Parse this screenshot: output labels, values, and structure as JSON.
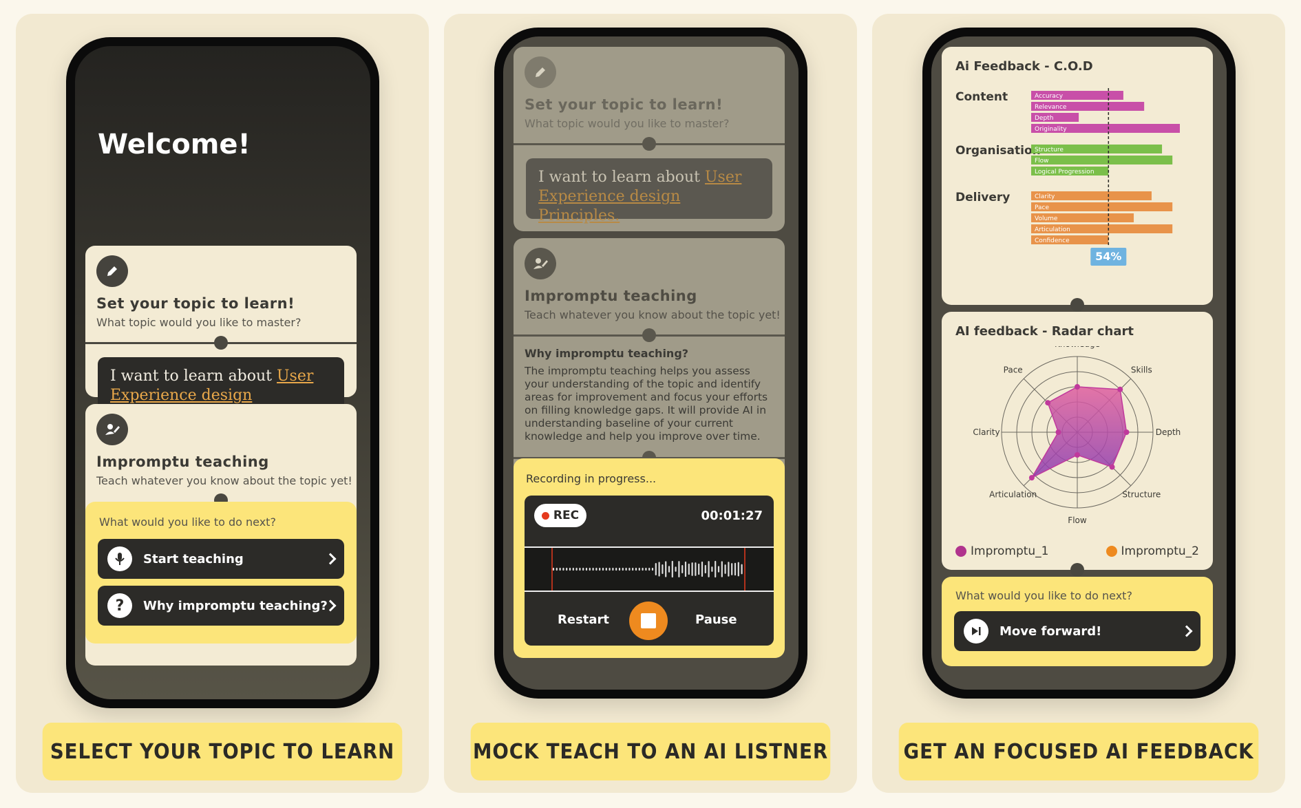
{
  "captions": [
    "SELECT YOUR TOPIC TO LEARN",
    "MOCK TEACH TO AN AI LISTNER",
    "GET AN FOCUSED AI FEEDBACK"
  ],
  "screen1": {
    "welcome": "Welcome!",
    "topic_card": {
      "title": "Set your topic to learn!",
      "subtitle": "What topic would you like to master?"
    },
    "topic_text_prefix": "I want to learn about ",
    "topic_text_highlight": "User Experience design Principles.",
    "impromptu_card": {
      "title": "Impromptu teaching",
      "subtitle": "Teach whatever you know about the topic yet!"
    },
    "next_prompt": "What would you like to do next?",
    "start_button": "Start teaching",
    "why_button": "Why impromptu teaching?"
  },
  "screen2": {
    "topic_card": {
      "title": "Set your topic to learn!",
      "subtitle": "What topic would you like to master?"
    },
    "topic_text_prefix": "I want to learn about ",
    "topic_text_highlight": "User Experience design Principles.",
    "impromptu_card": {
      "title": "Impromptu teaching",
      "subtitle": "Teach whatever you know about the topic yet!"
    },
    "why_title": "Why impromptu teaching?",
    "why_body": "The impromptu teaching helps you assess your understanding of the topic and identify areas for improvement and focus your efforts on filling knowledge gaps. It will provide AI in understanding baseline of your current knowledge and help you improve over time.",
    "recording_status": "Recording in progress...",
    "rec_label": "REC",
    "timer": "00:01:27",
    "restart_label": "Restart",
    "pause_label": "Pause"
  },
  "screen3": {
    "bar_title": "Ai Feedback - C.O.D",
    "radar_title": "AI feedback - Radar chart",
    "next_prompt": "What would you like to do next?",
    "forward_button": "Move forward!"
  },
  "chart_data": [
    {
      "type": "bar",
      "title": "Ai Feedback - C.O.D",
      "orientation": "horizontal",
      "groups": [
        {
          "name": "Content",
          "color": "#c84fa8",
          "items": [
            {
              "label": "Accuracy",
              "value": 62
            },
            {
              "label": "Relevance",
              "value": 76
            },
            {
              "label": "Depth",
              "value": 32
            },
            {
              "label": "Originality",
              "value": 100
            }
          ]
        },
        {
          "name": "Organisation",
          "color": "#7bbf4a",
          "items": [
            {
              "label": "Structure",
              "value": 88
            },
            {
              "label": "Flow",
              "value": 95
            },
            {
              "label": "Logical Progression",
              "value": 52
            }
          ]
        },
        {
          "name": "Delivery",
          "color": "#e8934a",
          "items": [
            {
              "label": "Clarity",
              "value": 81
            },
            {
              "label": "Pace",
              "value": 95
            },
            {
              "label": "Volume",
              "value": 69
            },
            {
              "label": "Articulation",
              "value": 95
            },
            {
              "label": "Confidence",
              "value": 52
            }
          ]
        }
      ],
      "reference_value": 52,
      "reference_label": "54%",
      "xlim": [
        0,
        100
      ]
    },
    {
      "type": "radar",
      "title": "AI feedback - Radar chart",
      "axes": [
        "Knowledge",
        "Skills",
        "Depth",
        "Structure",
        "Flow",
        "Articulation",
        "Clarity",
        "Pace"
      ],
      "series": [
        {
          "name": "Impromptu_1",
          "color": "#c0399c",
          "values": [
            0.6,
            0.8,
            0.65,
            0.65,
            0.3,
            0.85,
            0.25,
            0.55
          ]
        }
      ],
      "legend": [
        "Impromptu_1",
        "Impromptu_2"
      ],
      "legend_colors": [
        "#b0338d",
        "#ee8a1f"
      ],
      "rings": 5
    }
  ]
}
